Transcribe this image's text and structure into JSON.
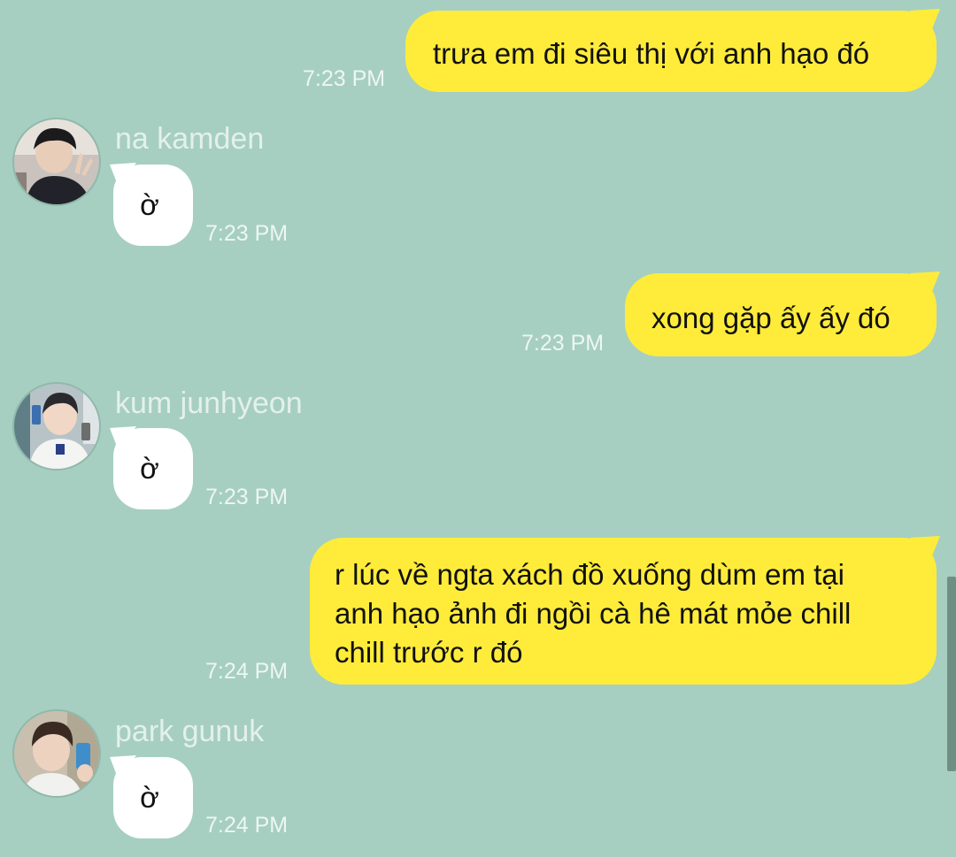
{
  "messages": [
    {
      "direction": "out",
      "text": "trưa em đi siêu thị với anh hạo đó",
      "time": "7:23 PM"
    },
    {
      "direction": "in",
      "sender": "na kamden",
      "avatar_icon": "person-selfie-peace-sign",
      "text": "ờ",
      "time": "7:23 PM"
    },
    {
      "direction": "out",
      "text": "xong gặp ấy ấy đó",
      "time": "7:23 PM"
    },
    {
      "direction": "in",
      "sender": "kum junhyeon",
      "avatar_icon": "person-holding-phone",
      "text": "ờ",
      "time": "7:23 PM"
    },
    {
      "direction": "out",
      "text": "r lúc về ngta xách đồ xuống dùm em tại\nanh hạo ảnh đi ngồi cà hê mát mỏe chill\nchill trước r đó",
      "time": "7:24 PM"
    },
    {
      "direction": "in",
      "sender": "park gunuk",
      "avatar_icon": "person-phone-selfie",
      "text": "ờ",
      "time": "7:24 PM"
    }
  ],
  "colors": {
    "background": "#a6cfc1",
    "outgoing_bubble": "#ffec3a",
    "incoming_bubble": "#ffffff",
    "timestamp": "#eef6f3",
    "sender_name": "#e4f0ec"
  }
}
